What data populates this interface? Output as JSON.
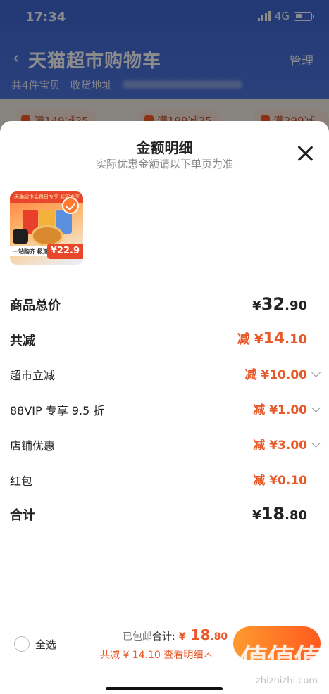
{
  "status_bar": {
    "time": "17:34",
    "network": "4G"
  },
  "header": {
    "title": "天猫超市购物车",
    "manage": "管理",
    "count_label": "共4件宝贝",
    "address_label": "收货地址"
  },
  "coupons": [
    "满149减25",
    "满199减35",
    "满299减5"
  ],
  "sheet": {
    "title": "金额明细",
    "subtitle": "实际优惠金额请以下单页为准",
    "product": {
      "banner_text": "天猫超市会员日专享 新客专享",
      "band_text": "一站购齐 极速送达",
      "price": "¥22.9"
    },
    "rows": [
      {
        "label": "商品总价",
        "prefix": "¥",
        "main": "32",
        "decimal": ".90"
      },
      {
        "label": "共减",
        "prefix": "减 ¥",
        "main": "14",
        "decimal": ".10"
      },
      {
        "label": "超市立减",
        "prefix": "减 ¥",
        "main": "10",
        "decimal": ".00"
      },
      {
        "label": "88VIP 专享 9.5 折",
        "prefix": "减 ¥",
        "main": "1",
        "decimal": ".00"
      },
      {
        "label": "店铺优惠",
        "prefix": "减 ¥",
        "main": "3",
        "decimal": ".00"
      },
      {
        "label": "红包",
        "prefix": "减 ¥",
        "main": "0",
        "decimal": ".10"
      },
      {
        "label": "合计",
        "prefix": "¥",
        "main": "18",
        "decimal": ".80"
      }
    ]
  },
  "footer": {
    "select_all": "全选",
    "shipped": "已包邮",
    "total_label": "合计:",
    "total_prefix": "¥",
    "total_main": "18",
    "total_decimal": ".80",
    "detail": "共减 ¥ 14.10  查看明细",
    "watermark_logo": "值值值",
    "watermark_url": "zhizhizhi.com"
  },
  "colors": {
    "accent": "#e8592a",
    "header_blue": "#4a74e0",
    "checkout_start": "#ff9a2e",
    "checkout_end": "#ff5a1f"
  }
}
